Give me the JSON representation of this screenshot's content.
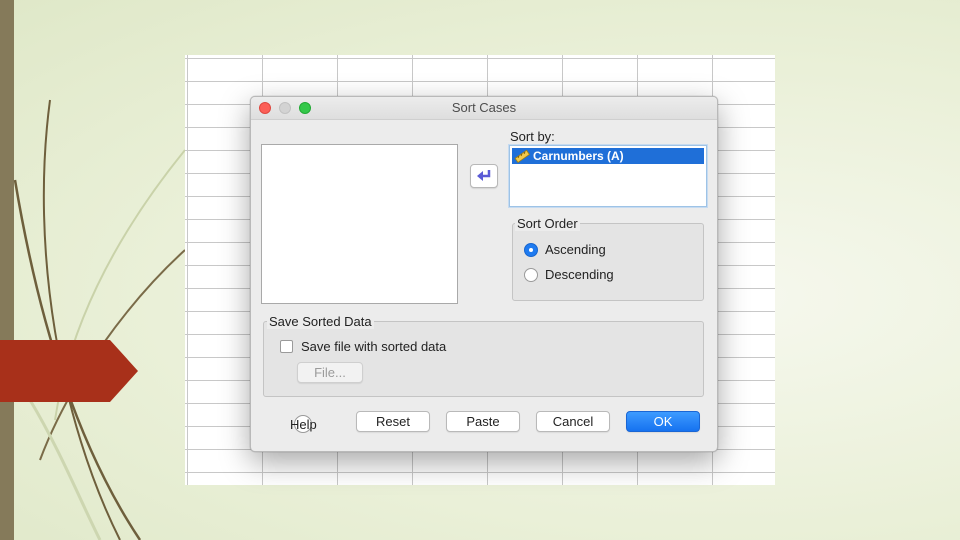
{
  "dialog": {
    "title": "Sort Cases",
    "sort_by_label": "Sort by:",
    "sort_by_items": [
      {
        "label": "Carnumbers (A)",
        "selected": true,
        "icon": "scale-ruler-icon"
      }
    ],
    "sort_order": {
      "legend": "Sort Order",
      "options": [
        {
          "label": "Ascending",
          "checked": true
        },
        {
          "label": "Descending",
          "checked": false
        }
      ]
    },
    "save_sorted": {
      "legend": "Save Sorted Data",
      "checkbox_label": "Save file with sorted data",
      "checkbox_checked": false,
      "file_button": "File..."
    },
    "buttons": {
      "help": "Help",
      "reset": "Reset",
      "paste": "Paste",
      "cancel": "Cancel",
      "ok": "OK"
    }
  },
  "colors": {
    "selection": "#1f6fd8",
    "primary_button": "#1672f0",
    "slide_accent_red": "#a8301a",
    "slide_bar": "#857a5a"
  }
}
